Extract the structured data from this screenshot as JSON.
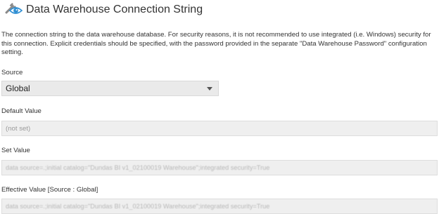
{
  "header": {
    "icon": "wrench-eye-icon",
    "title": "Data Warehouse Connection String"
  },
  "description": "The connection string to the data warehouse database. For security reasons, it is not recommended to use integrated (i.e. Windows) security for this connection. Explicit credentials should be specified, with the password provided in the separate \"Data Warehouse Password\" configuration setting.",
  "source": {
    "label": "Source",
    "selected": "Global",
    "caret_icon": "caret-down-icon"
  },
  "default_value": {
    "label": "Default Value",
    "value": "(not set)"
  },
  "set_value": {
    "label": "Set Value",
    "value": "data source=.;initial catalog=\"Dundas BI v1_02100019 Warehouse\";integrated security=True"
  },
  "effective_value": {
    "label": "Effective Value [Source : Global]",
    "value": "data source=.;initial catalog=\"Dundas BI v1_02100019 Warehouse\";integrated security=True"
  },
  "colors": {
    "icon_blue": "#2f8fd3",
    "icon_gray": "#8a8a8a",
    "field_bg": "#efefef",
    "select_bg": "#eaeaea"
  }
}
